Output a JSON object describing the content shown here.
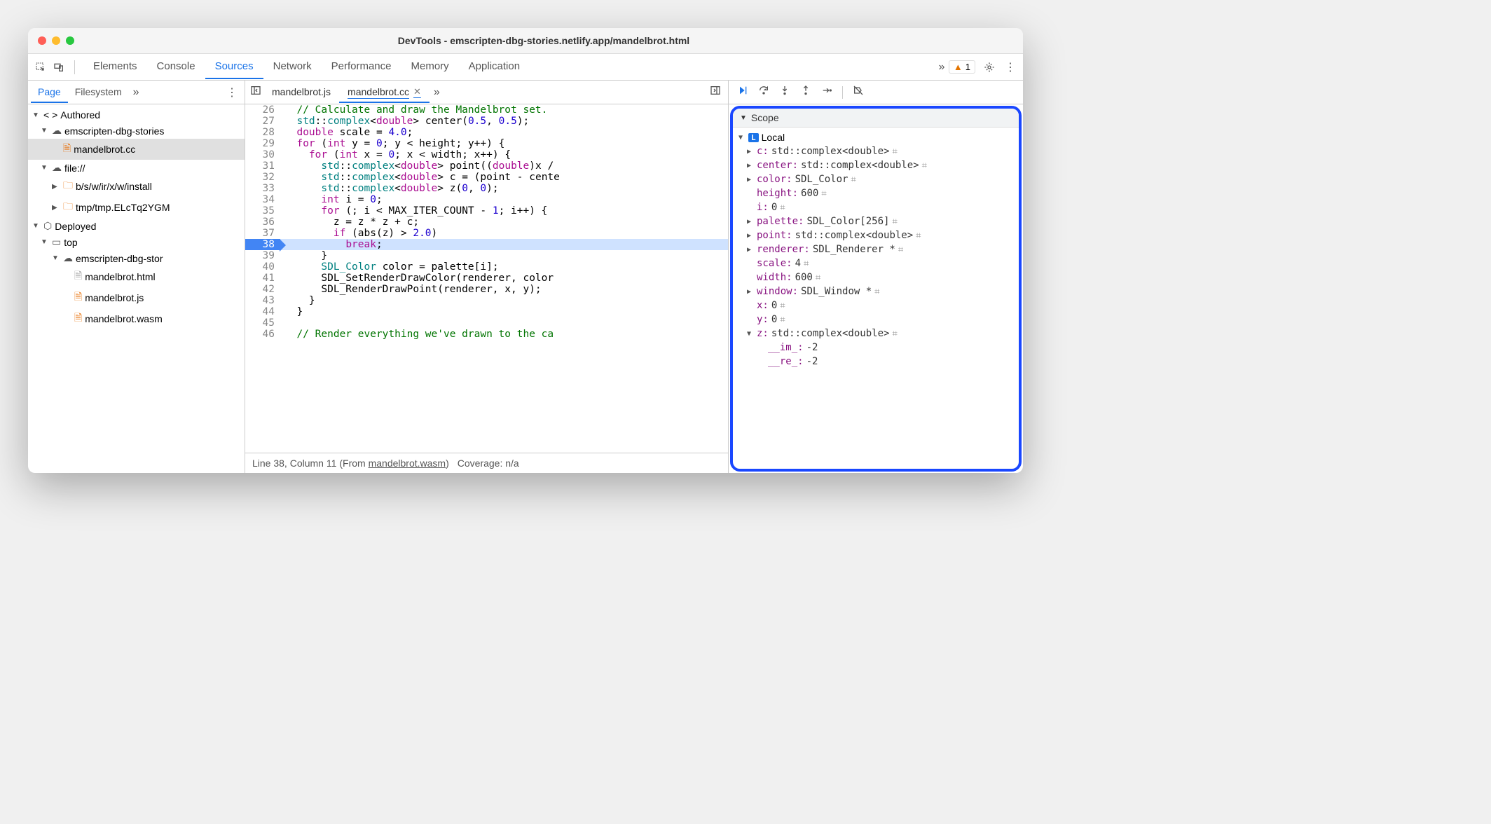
{
  "window": {
    "title": "DevTools - emscripten-dbg-stories.netlify.app/mandelbrot.html"
  },
  "toolbar": {
    "tabs": [
      "Elements",
      "Console",
      "Sources",
      "Network",
      "Performance",
      "Memory",
      "Application"
    ],
    "active_tab": "Sources",
    "warning_count": "1"
  },
  "sidebar": {
    "tabs": [
      "Page",
      "Filesystem"
    ],
    "active_tab": "Page",
    "tree": {
      "authored": "Authored",
      "deploy": "Deployed",
      "cloud1": "emscripten-dbg-stories",
      "file_cc": "mandelbrot.cc",
      "file_proto": "file://",
      "dir1": "b/s/w/ir/x/w/install",
      "dir2": "tmp/tmp.ELcTq2YGM",
      "top": "top",
      "cloud2": "emscripten-dbg-stor",
      "f_html": "mandelbrot.html",
      "f_js": "mandelbrot.js",
      "f_wasm": "mandelbrot.wasm"
    }
  },
  "editor": {
    "tabs": [
      {
        "label": "mandelbrot.js",
        "active": false,
        "closeable": false
      },
      {
        "label": "mandelbrot.cc",
        "active": true,
        "closeable": true
      }
    ],
    "lines": [
      {
        "n": 26,
        "html": "  <span class='comment'>// Calculate and draw the Mandelbrot set.</span>"
      },
      {
        "n": 27,
        "html": "  <span class='type'>std</span>::<span class='type'>complex</span>&lt;<span class='kw'>double</span>&gt; center(<span class='num'>0.5</span>, <span class='num'>0.5</span>);"
      },
      {
        "n": 28,
        "html": "  <span class='kw'>double</span> scale = <span class='num'>4.0</span>;"
      },
      {
        "n": 29,
        "html": "  <span class='kw'>for</span> (<span class='kw'>int</span> y = <span class='num'>0</span>; y &lt; height; y++) {"
      },
      {
        "n": 30,
        "html": "    <span class='kw'>for</span> (<span class='kw'>int</span> x = <span class='num'>0</span>; x &lt; width; x++) {"
      },
      {
        "n": 31,
        "html": "      <span class='type'>std</span>::<span class='type'>complex</span>&lt;<span class='kw'>double</span>&gt; point((<span class='kw'>double</span>)x /"
      },
      {
        "n": 32,
        "html": "      <span class='type'>std</span>::<span class='type'>complex</span>&lt;<span class='kw'>double</span>&gt; c = (point - cente"
      },
      {
        "n": 33,
        "html": "      <span class='type'>std</span>::<span class='type'>complex</span>&lt;<span class='kw'>double</span>&gt; z(<span class='num'>0</span>, <span class='num'>0</span>);"
      },
      {
        "n": 34,
        "html": "      <span class='kw'>int</span> i = <span class='num'>0</span>;"
      },
      {
        "n": 35,
        "html": "      <span class='kw'>for</span> (; i &lt; MAX_ITER_COUNT - <span class='num'>1</span>; i++) {"
      },
      {
        "n": 36,
        "html": "        z = z * z + c;"
      },
      {
        "n": 37,
        "html": "        <span class='kw'>if</span> (abs(z) &gt; <span class='num'>2.0</span>)"
      },
      {
        "n": 38,
        "html": "          <span class='kw'>break</span>;",
        "bp": true,
        "hl": true
      },
      {
        "n": 39,
        "html": "      }"
      },
      {
        "n": 40,
        "html": "      <span class='type'>SDL_Color</span> color = palette[i];"
      },
      {
        "n": 41,
        "html": "      SDL_SetRenderDrawColor(renderer, color"
      },
      {
        "n": 42,
        "html": "      SDL_RenderDrawPoint(renderer, x, y);"
      },
      {
        "n": 43,
        "html": "    }"
      },
      {
        "n": 44,
        "html": "  }"
      },
      {
        "n": 45,
        "html": ""
      },
      {
        "n": 46,
        "html": "  <span class='comment'>// Render everything we've drawn to the ca</span>"
      }
    ]
  },
  "statusbar": {
    "position": "Line 38, Column 11",
    "from_label": "(From ",
    "from_file": "mandelbrot.wasm",
    "from_close": ")",
    "coverage": "Coverage: n/a"
  },
  "scope": {
    "header": "Scope",
    "local_label": "Local",
    "vars": [
      {
        "exp": true,
        "arr": "▶",
        "name": "c",
        "val": "std::complex<double>",
        "mem": true
      },
      {
        "exp": true,
        "arr": "▶",
        "name": "center",
        "val": "std::complex<double>",
        "mem": true
      },
      {
        "exp": true,
        "arr": "▶",
        "name": "color",
        "val": "SDL_Color",
        "mem": true
      },
      {
        "exp": false,
        "arr": "",
        "name": "height",
        "val": "600",
        "mem": true
      },
      {
        "exp": false,
        "arr": "",
        "name": "i",
        "val": "0",
        "mem": true
      },
      {
        "exp": true,
        "arr": "▶",
        "name": "palette",
        "val": "SDL_Color[256]",
        "mem": true
      },
      {
        "exp": true,
        "arr": "▶",
        "name": "point",
        "val": "std::complex<double>",
        "mem": true
      },
      {
        "exp": true,
        "arr": "▶",
        "name": "renderer",
        "val": "SDL_Renderer *",
        "mem": true
      },
      {
        "exp": false,
        "arr": "",
        "name": "scale",
        "val": "4",
        "mem": true
      },
      {
        "exp": false,
        "arr": "",
        "name": "width",
        "val": "600",
        "mem": true
      },
      {
        "exp": true,
        "arr": "▶",
        "name": "window",
        "val": "SDL_Window *",
        "mem": true
      },
      {
        "exp": false,
        "arr": "",
        "name": "x",
        "val": "0",
        "mem": true
      },
      {
        "exp": false,
        "arr": "",
        "name": "y",
        "val": "0",
        "mem": true
      },
      {
        "exp": true,
        "arr": "▼",
        "name": "z",
        "val": "std::complex<double>",
        "mem": true
      },
      {
        "child": true,
        "name": "__im_",
        "val": "-2"
      },
      {
        "child": true,
        "name": "__re_",
        "val": "-2"
      }
    ]
  }
}
